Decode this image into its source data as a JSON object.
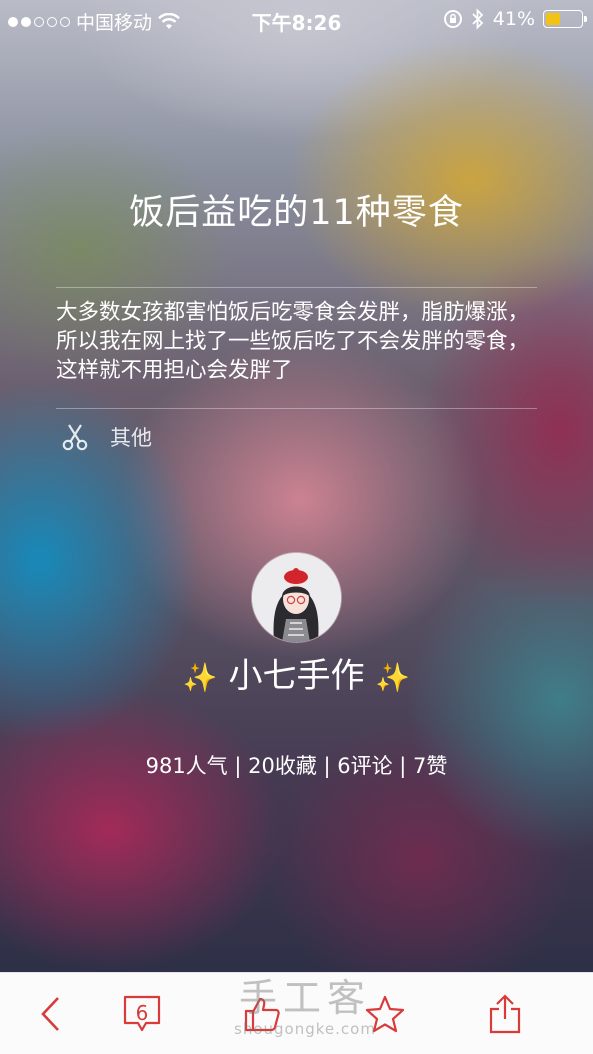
{
  "status_bar": {
    "carrier": "中国移动",
    "time": "下午8:26",
    "battery_percent": "41%",
    "battery_level": 0.41,
    "signal_bars": 2,
    "signal_total": 5
  },
  "article": {
    "title": "饭后益吃的11种零食",
    "description": "大多数女孩都害怕饭后吃零食会发胖，脂肪爆涨，所以我在网上找了一些饭后吃了不会发胖的零食，这样就不用担心会发胖了",
    "category": "其他",
    "category_icon": "scissors-icon"
  },
  "author": {
    "name": "小七手作",
    "sparkle_left": "✨",
    "sparkle_right": "✨"
  },
  "stats": {
    "text": "981人气 | 20收藏 | 6评论 | 7赞"
  },
  "toolbar": {
    "comment_count": "6",
    "watermark_cn": "手工客",
    "watermark_en": "shougongke.com",
    "accent_color": "#d93a3a"
  }
}
